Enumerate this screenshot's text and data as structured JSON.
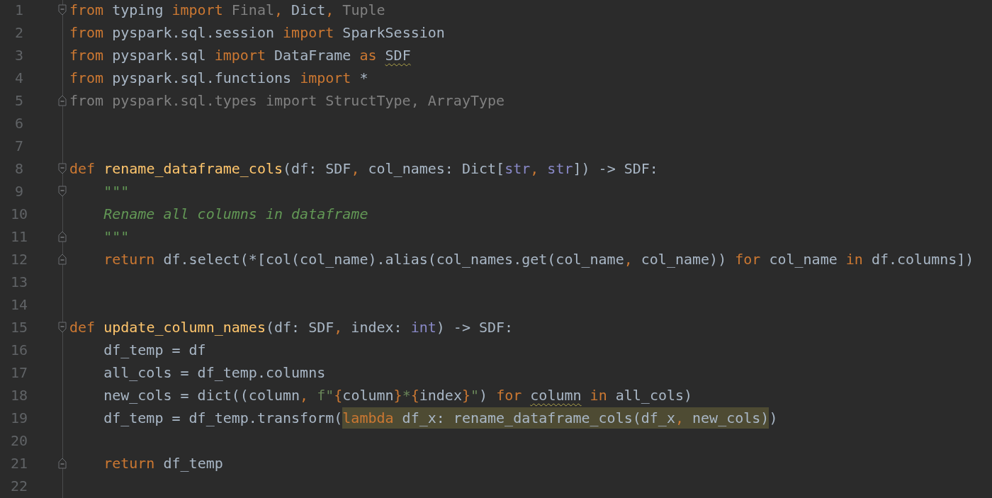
{
  "editor": {
    "lines": [
      {
        "number": "1",
        "fold_start": true,
        "tokens": [
          {
            "text": "from",
            "kind": "keyword"
          },
          {
            "text": " typing ",
            "kind": "name"
          },
          {
            "text": "import",
            "kind": "keyword"
          },
          {
            "text": " Final",
            "kind": "unused"
          },
          {
            "text": ",",
            "kind": "punct"
          },
          {
            "text": " Dict",
            "kind": "name"
          },
          {
            "text": ",",
            "kind": "punct"
          },
          {
            "text": " Tuple",
            "kind": "unused"
          }
        ]
      },
      {
        "number": "2",
        "tokens": [
          {
            "text": "from",
            "kind": "keyword"
          },
          {
            "text": " pyspark.sql.session ",
            "kind": "name"
          },
          {
            "text": "import",
            "kind": "keyword"
          },
          {
            "text": " SparkSession",
            "kind": "name"
          }
        ]
      },
      {
        "number": "3",
        "tokens": [
          {
            "text": "from",
            "kind": "keyword"
          },
          {
            "text": " pyspark.sql ",
            "kind": "name"
          },
          {
            "text": "import",
            "kind": "keyword"
          },
          {
            "text": " DataFrame ",
            "kind": "name"
          },
          {
            "text": "as ",
            "kind": "keyword"
          },
          {
            "text": "SDF",
            "kind": "name",
            "warning": true
          }
        ]
      },
      {
        "number": "4",
        "tokens": [
          {
            "text": "from",
            "kind": "keyword"
          },
          {
            "text": " pyspark.sql.functions ",
            "kind": "name"
          },
          {
            "text": "import",
            "kind": "keyword"
          },
          {
            "text": " *",
            "kind": "name"
          }
        ]
      },
      {
        "number": "5",
        "fold_end": true,
        "tokens": [
          {
            "text": "from pyspark.sql.types import StructType, ArrayType",
            "kind": "unused"
          }
        ]
      },
      {
        "number": "6"
      },
      {
        "number": "7"
      },
      {
        "number": "8",
        "fold_start": true,
        "tokens": [
          {
            "text": "def ",
            "kind": "keyword"
          },
          {
            "text": "rename_dataframe_cols",
            "kind": "function"
          },
          {
            "text": "(df: SDF",
            "kind": "name"
          },
          {
            "text": ",",
            "kind": "punct"
          },
          {
            "text": " col_names: Dict[",
            "kind": "name"
          },
          {
            "text": "str",
            "kind": "builtin"
          },
          {
            "text": ", ",
            "kind": "punct"
          },
          {
            "text": "str",
            "kind": "builtin"
          },
          {
            "text": "]) -> SDF:",
            "kind": "name"
          }
        ]
      },
      {
        "number": "9",
        "fold_start": true,
        "tokens": [
          {
            "text": "    \"\"\"",
            "kind": "docstring"
          }
        ]
      },
      {
        "number": "10",
        "tokens": [
          {
            "text": "    Rename all columns in dataframe",
            "kind": "docstring"
          }
        ]
      },
      {
        "number": "11",
        "fold_end": true,
        "tokens": [
          {
            "text": "    \"\"\"",
            "kind": "docstring"
          }
        ]
      },
      {
        "number": "12",
        "fold_end": true,
        "tokens": [
          {
            "text": "    return",
            "kind": "keyword"
          },
          {
            "text": " df.select(*[col(col_name).alias(col_names.get(col_name",
            "kind": "name"
          },
          {
            "text": ",",
            "kind": "punct"
          },
          {
            "text": " col_name)) ",
            "kind": "name"
          },
          {
            "text": "for",
            "kind": "keyword"
          },
          {
            "text": " col_name ",
            "kind": "name"
          },
          {
            "text": "in",
            "kind": "keyword"
          },
          {
            "text": " df.columns])",
            "kind": "name"
          }
        ]
      },
      {
        "number": "13"
      },
      {
        "number": "14"
      },
      {
        "number": "15",
        "fold_start": true,
        "tokens": [
          {
            "text": "def ",
            "kind": "keyword"
          },
          {
            "text": "update_column_names",
            "kind": "function"
          },
          {
            "text": "(df: SDF",
            "kind": "name"
          },
          {
            "text": ",",
            "kind": "punct"
          },
          {
            "text": " index: ",
            "kind": "name"
          },
          {
            "text": "int",
            "kind": "builtin"
          },
          {
            "text": ") -> SDF:",
            "kind": "name"
          }
        ]
      },
      {
        "number": "16",
        "tokens": [
          {
            "text": "    df_temp = df",
            "kind": "name"
          }
        ]
      },
      {
        "number": "17",
        "tokens": [
          {
            "text": "    all_cols = df_temp.columns",
            "kind": "name"
          }
        ]
      },
      {
        "number": "18",
        "tokens": [
          {
            "text": "    new_cols = dict((column",
            "kind": "name"
          },
          {
            "text": ", ",
            "kind": "punct"
          },
          {
            "text": "f\"",
            "kind": "string"
          },
          {
            "text": "{",
            "kind": "punct"
          },
          {
            "text": "column",
            "kind": "name"
          },
          {
            "text": "}",
            "kind": "punct"
          },
          {
            "text": "*",
            "kind": "string"
          },
          {
            "text": "{",
            "kind": "punct"
          },
          {
            "text": "index",
            "kind": "name"
          },
          {
            "text": "}",
            "kind": "punct"
          },
          {
            "text": "\"",
            "kind": "string"
          },
          {
            "text": ") ",
            "kind": "name"
          },
          {
            "text": "for ",
            "kind": "keyword"
          },
          {
            "text": "column",
            "kind": "name",
            "warning": true
          },
          {
            "text": " in",
            "kind": "keyword"
          },
          {
            "text": " all_cols)",
            "kind": "name"
          }
        ]
      },
      {
        "number": "19",
        "tokens": [
          {
            "text": "    df_temp = df_temp.transform(",
            "kind": "name"
          },
          {
            "text": "lambda",
            "kind": "keyword",
            "highlighted": true
          },
          {
            "text": " df_x: rename_dataframe_cols(df_x",
            "kind": "name",
            "highlighted": true
          },
          {
            "text": ",",
            "kind": "punct",
            "highlighted": true
          },
          {
            "text": " new_cols)",
            "kind": "name",
            "highlighted": true
          },
          {
            "text": ")",
            "kind": "name"
          }
        ]
      },
      {
        "number": "20"
      },
      {
        "number": "21",
        "fold_end": true,
        "tokens": [
          {
            "text": "    return",
            "kind": "keyword"
          },
          {
            "text": " df_temp",
            "kind": "name"
          }
        ]
      },
      {
        "number": "22"
      }
    ]
  }
}
